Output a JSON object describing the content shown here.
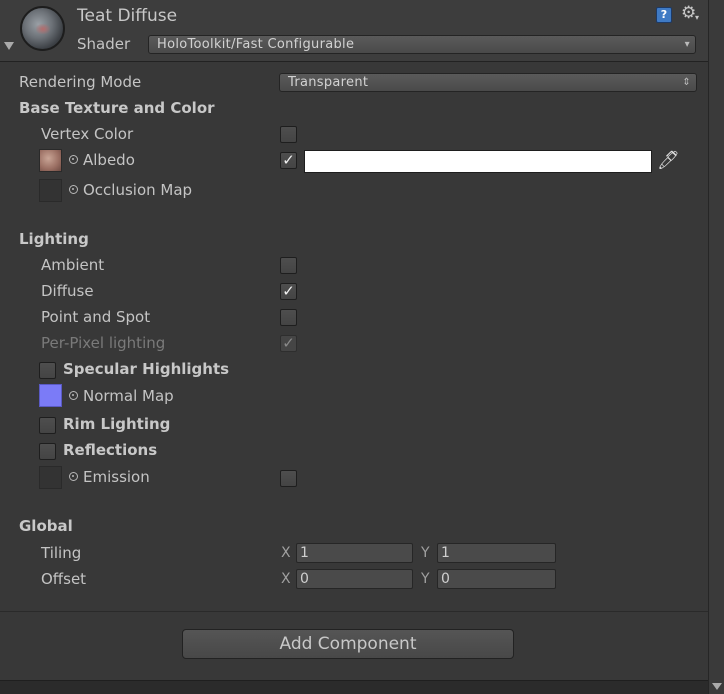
{
  "header": {
    "title": "Teat Diffuse",
    "shader_label": "Shader",
    "shader_value": "HoloToolkit/Fast Configurable",
    "help_icon": "?",
    "gear_icon": "⚙",
    "caret": "▾"
  },
  "rendering": {
    "label": "Rendering Mode",
    "value": "Transparent",
    "caret": "⇕"
  },
  "base": {
    "heading": "Base Texture and Color",
    "vertex_color": {
      "label": "Vertex Color",
      "checked": ""
    },
    "albedo": {
      "label": "Albedo",
      "checked": "✓",
      "color": "#ffffff"
    },
    "occlusion": {
      "label": "Occlusion Map"
    }
  },
  "lighting": {
    "heading": "Lighting",
    "ambient": {
      "label": "Ambient",
      "checked": ""
    },
    "diffuse": {
      "label": "Diffuse",
      "checked": "✓"
    },
    "point_spot": {
      "label": "Point and Spot",
      "checked": ""
    },
    "per_pixel": {
      "label": "Per-Pixel lighting",
      "checked": "✓"
    },
    "specular": {
      "label": "Specular Highlights",
      "checked": ""
    },
    "normal_map": {
      "label": "Normal Map"
    },
    "rim": {
      "label": "Rim Lighting",
      "checked": ""
    },
    "reflections": {
      "label": "Reflections",
      "checked": ""
    },
    "emission": {
      "label": "Emission",
      "checked": ""
    }
  },
  "global": {
    "heading": "Global",
    "tiling": {
      "label": "Tiling",
      "x_axis": "X",
      "x": "1",
      "y_axis": "Y",
      "y": "1"
    },
    "offset": {
      "label": "Offset",
      "x_axis": "X",
      "x": "0",
      "y_axis": "Y",
      "y": "0"
    }
  },
  "add_component": "Add Component",
  "colors": {
    "background": "#383838",
    "normal_map": "#7b7bf7",
    "help": "#3f7ac4"
  }
}
